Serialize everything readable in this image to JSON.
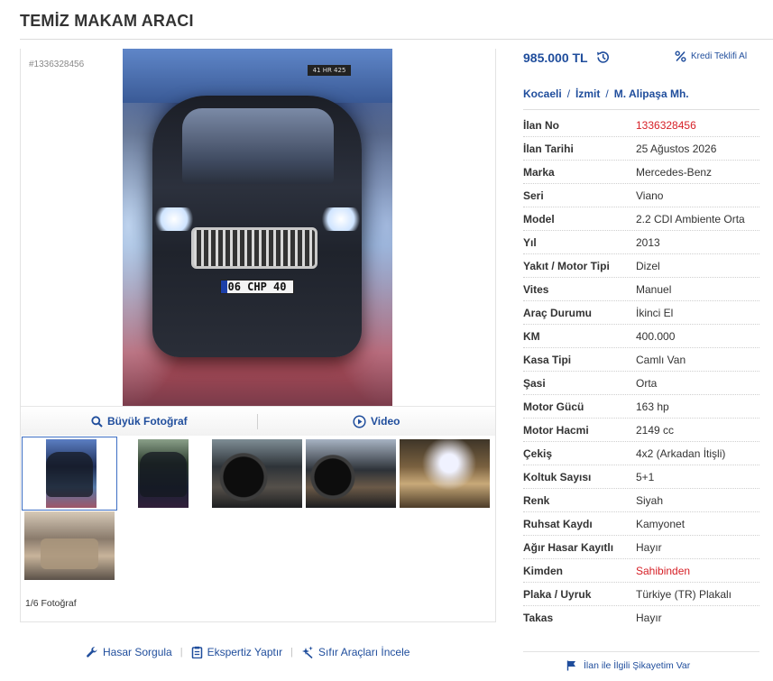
{
  "listing": {
    "title": "TEMİZ MAKAM ARACI",
    "id_label": "#1336328456"
  },
  "photo": {
    "plate_text": "06 CHP 40",
    "sign_text": "41 HR 425",
    "big_photo_label": "Büyük Fotoğraf",
    "video_label": "Video",
    "count_label": "1/6 Fotoğraf"
  },
  "links": {
    "damage_query": "Hasar Sorgula",
    "expertise": "Ekspertiz Yaptır",
    "new_cars": "Sıfır Araçları İncele"
  },
  "price": {
    "value": "985.000 TL",
    "credit_label": "Kredi Teklifi Al"
  },
  "location": {
    "city": "Kocaeli",
    "district": "İzmit",
    "neighborhood": "M. Alipaşa Mh."
  },
  "specs": [
    {
      "key": "İlan No",
      "value": "1336328456",
      "highlight": true
    },
    {
      "key": "İlan Tarihi",
      "value": "25 Ağustos 2026",
      "highlight": false
    },
    {
      "key": "Marka",
      "value": "Mercedes-Benz",
      "highlight": false
    },
    {
      "key": "Seri",
      "value": "Viano",
      "highlight": false
    },
    {
      "key": "Model",
      "value": "2.2 CDI Ambiente Orta",
      "highlight": false
    },
    {
      "key": "Yıl",
      "value": "2013",
      "highlight": false
    },
    {
      "key": "Yakıt / Motor Tipi",
      "value": "Dizel",
      "highlight": false
    },
    {
      "key": "Vites",
      "value": "Manuel",
      "highlight": false
    },
    {
      "key": "Araç Durumu",
      "value": "İkinci El",
      "highlight": false
    },
    {
      "key": "KM",
      "value": "400.000",
      "highlight": false
    },
    {
      "key": "Kasa Tipi",
      "value": "Camlı Van",
      "highlight": false
    },
    {
      "key": "Şasi",
      "value": "Orta",
      "highlight": false
    },
    {
      "key": "Motor Gücü",
      "value": "163 hp",
      "highlight": false
    },
    {
      "key": "Motor Hacmi",
      "value": "2149 cc",
      "highlight": false
    },
    {
      "key": "Çekiş",
      "value": "4x2 (Arkadan İtişli)",
      "highlight": false
    },
    {
      "key": "Koltuk Sayısı",
      "value": "5+1",
      "highlight": false
    },
    {
      "key": "Renk",
      "value": "Siyah",
      "highlight": false
    },
    {
      "key": "Ruhsat Kaydı",
      "value": "Kamyonet",
      "highlight": false
    },
    {
      "key": "Ağır Hasar Kayıtlı",
      "value": "Hayır",
      "highlight": false
    },
    {
      "key": "Kimden",
      "value": "Sahibinden",
      "highlight": true
    },
    {
      "key": "Plaka / Uyruk",
      "value": "Türkiye (TR) Plakalı",
      "highlight": false
    },
    {
      "key": "Takas",
      "value": "Hayır",
      "highlight": false
    }
  ],
  "complaint_label": "İlan ile İlgili Şikayetim Var",
  "colors": {
    "link_blue": "#1f4d9c",
    "highlight_red": "#d61f26",
    "text": "#333333"
  }
}
